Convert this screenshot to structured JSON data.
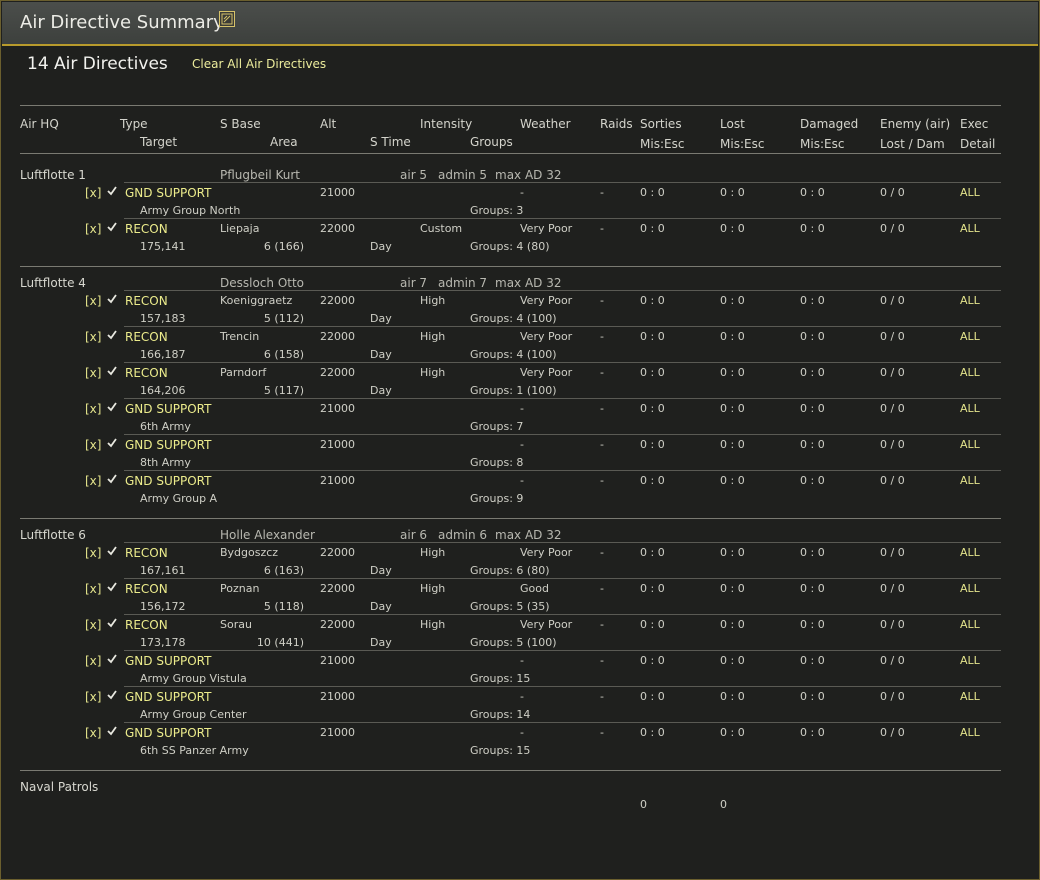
{
  "window": {
    "title": "Air Directive Summary",
    "count_title": "14 Air Directives",
    "clear_all": "Clear All Air Directives"
  },
  "headers": {
    "air_hq": "Air HQ",
    "type": "Type",
    "target": "Target",
    "s_base": "S Base",
    "area": "Area",
    "alt": "Alt",
    "s_time": "S Time",
    "intensity": "Intensity",
    "groups": "Groups",
    "weather": "Weather",
    "raids": "Raids",
    "sorties": "Sorties",
    "sorties_sub": "Mis:Esc",
    "lost": "Lost",
    "lost_sub": "Mis:Esc",
    "damaged": "Damaged",
    "damaged_sub": "Mis:Esc",
    "enemy": "Enemy (air)",
    "enemy_sub": "Lost / Dam",
    "exec": "Exec",
    "exec_sub": "Detail"
  },
  "hqs": [
    {
      "name": "Luftflotte 1",
      "commander": "Pflugbeil Kurt",
      "air": "air 5",
      "admin": "admin 5",
      "max": "max AD 32",
      "directives": [
        {
          "x": "[x]",
          "type": "GND SUPPORT",
          "base": "",
          "alt": "21000",
          "intensity": "",
          "weather": "-",
          "raids": "-",
          "sorties": "0 : 0",
          "lost": "0 : 0",
          "damaged": "0 : 0",
          "enemy": "0 / 0",
          "exec": "ALL",
          "target": "Army Group North",
          "area": "",
          "stime": "",
          "groups": "Groups: 3"
        },
        {
          "x": "[x]",
          "type": "RECON",
          "base": "Liepaja",
          "alt": "22000",
          "intensity": "Custom",
          "weather": "Very Poor",
          "raids": "-",
          "sorties": "0 : 0",
          "lost": "0 : 0",
          "damaged": "0 : 0",
          "enemy": "0 / 0",
          "exec": "ALL",
          "target": "175,141",
          "area": "6 (166)",
          "stime": "Day",
          "groups": "Groups: 4  (80)"
        }
      ]
    },
    {
      "name": "Luftflotte 4",
      "commander": "Dessloch Otto",
      "air": "air 7",
      "admin": "admin 7",
      "max": "max AD 32",
      "directives": [
        {
          "x": "[x]",
          "type": "RECON",
          "base": "Koeniggraetz",
          "alt": "22000",
          "intensity": "High",
          "weather": "Very Poor",
          "raids": "-",
          "sorties": "0 : 0",
          "lost": "0 : 0",
          "damaged": "0 : 0",
          "enemy": "0 / 0",
          "exec": "ALL",
          "target": "157,183",
          "area": "5 (112)",
          "stime": "Day",
          "groups": "Groups: 4  (100)"
        },
        {
          "x": "[x]",
          "type": "RECON",
          "base": "Trencin",
          "alt": "22000",
          "intensity": "High",
          "weather": "Very Poor",
          "raids": "-",
          "sorties": "0 : 0",
          "lost": "0 : 0",
          "damaged": "0 : 0",
          "enemy": "0 / 0",
          "exec": "ALL",
          "target": "166,187",
          "area": "6 (158)",
          "stime": "Day",
          "groups": "Groups: 4  (100)"
        },
        {
          "x": "[x]",
          "type": "RECON",
          "base": "Parndorf",
          "alt": "22000",
          "intensity": "High",
          "weather": "Very Poor",
          "raids": "-",
          "sorties": "0 : 0",
          "lost": "0 : 0",
          "damaged": "0 : 0",
          "enemy": "0 / 0",
          "exec": "ALL",
          "target": "164,206",
          "area": "5 (117)",
          "stime": "Day",
          "groups": "Groups: 1  (100)"
        },
        {
          "x": "[x]",
          "type": "GND SUPPORT",
          "base": "",
          "alt": "21000",
          "intensity": "",
          "weather": "-",
          "raids": "-",
          "sorties": "0 : 0",
          "lost": "0 : 0",
          "damaged": "0 : 0",
          "enemy": "0 / 0",
          "exec": "ALL",
          "target": "6th Army",
          "area": "",
          "stime": "",
          "groups": "Groups: 7"
        },
        {
          "x": "[x]",
          "type": "GND SUPPORT",
          "base": "",
          "alt": "21000",
          "intensity": "",
          "weather": "-",
          "raids": "-",
          "sorties": "0 : 0",
          "lost": "0 : 0",
          "damaged": "0 : 0",
          "enemy": "0 / 0",
          "exec": "ALL",
          "target": "8th Army",
          "area": "",
          "stime": "",
          "groups": "Groups: 8"
        },
        {
          "x": "[x]",
          "type": "GND SUPPORT",
          "base": "",
          "alt": "21000",
          "intensity": "",
          "weather": "-",
          "raids": "-",
          "sorties": "0 : 0",
          "lost": "0 : 0",
          "damaged": "0 : 0",
          "enemy": "0 / 0",
          "exec": "ALL",
          "target": "Army Group A",
          "area": "",
          "stime": "",
          "groups": "Groups: 9"
        }
      ]
    },
    {
      "name": "Luftflotte 6",
      "commander": "Holle Alexander",
      "air": "air 6",
      "admin": "admin 6",
      "max": "max AD 32",
      "directives": [
        {
          "x": "[x]",
          "type": "RECON",
          "base": "Bydgoszcz",
          "alt": "22000",
          "intensity": "High",
          "weather": "Very Poor",
          "raids": "-",
          "sorties": "0 : 0",
          "lost": "0 : 0",
          "damaged": "0 : 0",
          "enemy": "0 / 0",
          "exec": "ALL",
          "target": "167,161",
          "area": "6 (163)",
          "stime": "Day",
          "groups": "Groups: 6  (80)"
        },
        {
          "x": "[x]",
          "type": "RECON",
          "base": "Poznan",
          "alt": "22000",
          "intensity": "High",
          "weather": "Good",
          "raids": "-",
          "sorties": "0 : 0",
          "lost": "0 : 0",
          "damaged": "0 : 0",
          "enemy": "0 / 0",
          "exec": "ALL",
          "target": "156,172",
          "area": "5 (118)",
          "stime": "Day",
          "groups": "Groups: 5  (35)"
        },
        {
          "x": "[x]",
          "type": "RECON",
          "base": "Sorau",
          "alt": "22000",
          "intensity": "High",
          "weather": "Very Poor",
          "raids": "-",
          "sorties": "0 : 0",
          "lost": "0 : 0",
          "damaged": "0 : 0",
          "enemy": "0 / 0",
          "exec": "ALL",
          "target": "173,178",
          "area": "10 (441)",
          "stime": "Day",
          "groups": "Groups: 5  (100)"
        },
        {
          "x": "[x]",
          "type": "GND SUPPORT",
          "base": "",
          "alt": "21000",
          "intensity": "",
          "weather": "-",
          "raids": "-",
          "sorties": "0 : 0",
          "lost": "0 : 0",
          "damaged": "0 : 0",
          "enemy": "0 / 0",
          "exec": "ALL",
          "target": "Army Group Vistula",
          "area": "",
          "stime": "",
          "groups": "Groups: 15"
        },
        {
          "x": "[x]",
          "type": "GND SUPPORT",
          "base": "",
          "alt": "21000",
          "intensity": "",
          "weather": "-",
          "raids": "-",
          "sorties": "0 : 0",
          "lost": "0 : 0",
          "damaged": "0 : 0",
          "enemy": "0 / 0",
          "exec": "ALL",
          "target": "Army Group Center",
          "area": "",
          "stime": "",
          "groups": "Groups: 14"
        },
        {
          "x": "[x]",
          "type": "GND SUPPORT",
          "base": "",
          "alt": "21000",
          "intensity": "",
          "weather": "-",
          "raids": "-",
          "sorties": "0 : 0",
          "lost": "0 : 0",
          "damaged": "0 : 0",
          "enemy": "0 / 0",
          "exec": "ALL",
          "target": "6th SS Panzer Army",
          "area": "",
          "stime": "",
          "groups": "Groups: 15"
        }
      ]
    }
  ],
  "naval": {
    "label": "Naval Patrols",
    "sorties": "0",
    "lost": "0"
  }
}
